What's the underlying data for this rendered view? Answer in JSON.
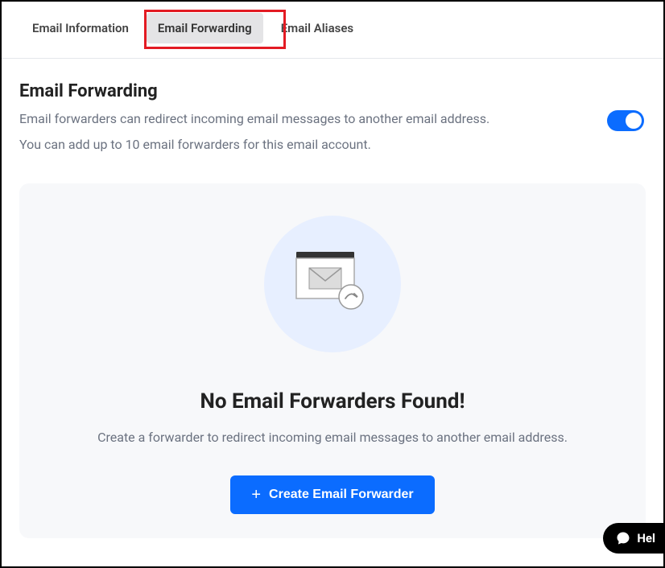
{
  "tabs": {
    "info": "Email Information",
    "forwarding": "Email Forwarding",
    "aliases": "Email Aliases"
  },
  "section": {
    "title": "Email Forwarding",
    "desc1": "Email forwarders can redirect incoming email messages to another email address.",
    "desc2": "You can add up to 10 email forwarders for this email account."
  },
  "empty": {
    "title": "No Email Forwarders Found!",
    "desc": "Create a forwarder to redirect incoming email messages to another email address.",
    "button": "Create Email Forwarder"
  },
  "help": {
    "label": "Hel"
  }
}
